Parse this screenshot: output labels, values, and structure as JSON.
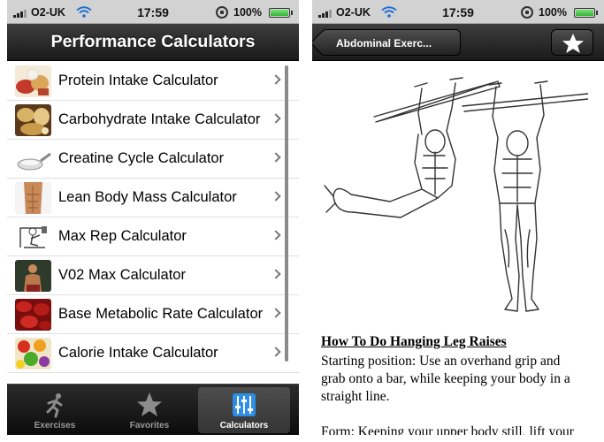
{
  "status_bar": {
    "carrier": "O2-UK",
    "time": "17:59",
    "battery": "100%",
    "battery_level": 1.0
  },
  "left_screen": {
    "nav_title": "Performance Calculators",
    "calculators": [
      {
        "label": "Protein Intake Calculator",
        "thumbnail": "protein-foods-photo"
      },
      {
        "label": "Carbohydrate Intake Calculator",
        "thumbnail": "carbohydrate-foods-photo"
      },
      {
        "label": "Creatine Cycle Calculator",
        "thumbnail": "creatine-scoop-photo"
      },
      {
        "label": "Lean Body Mass Calculator",
        "thumbnail": "torso-photo"
      },
      {
        "label": "Max Rep Calculator",
        "thumbnail": "weightlifting-machine-drawing"
      },
      {
        "label": "V02 Max Calculator",
        "thumbnail": "athlete-photo"
      },
      {
        "label": "Base Metabolic Rate Calculator",
        "thumbnail": "blood-cells-photo"
      },
      {
        "label": "Calorie Intake Calculator",
        "thumbnail": "fruit-vegetables-photo"
      }
    ],
    "tabs": [
      {
        "label": "Exercises",
        "icon": "runner-icon",
        "active": false
      },
      {
        "label": "Favorites",
        "icon": "star-icon",
        "active": false
      },
      {
        "label": "Calculators",
        "icon": "equalizer-icon",
        "active": true
      }
    ]
  },
  "right_screen": {
    "back_label": "Abdominal Exerc...",
    "favorite_icon": "star-icon",
    "illustration": "hanging-leg-raise-drawing",
    "article_title": "How To Do Hanging Leg Raises",
    "article_body": "Starting position: Use an overhand grip and grab onto a bar, while keeping your body in a straight line.\n\nForm: Keeping your upper body still, lift your"
  }
}
